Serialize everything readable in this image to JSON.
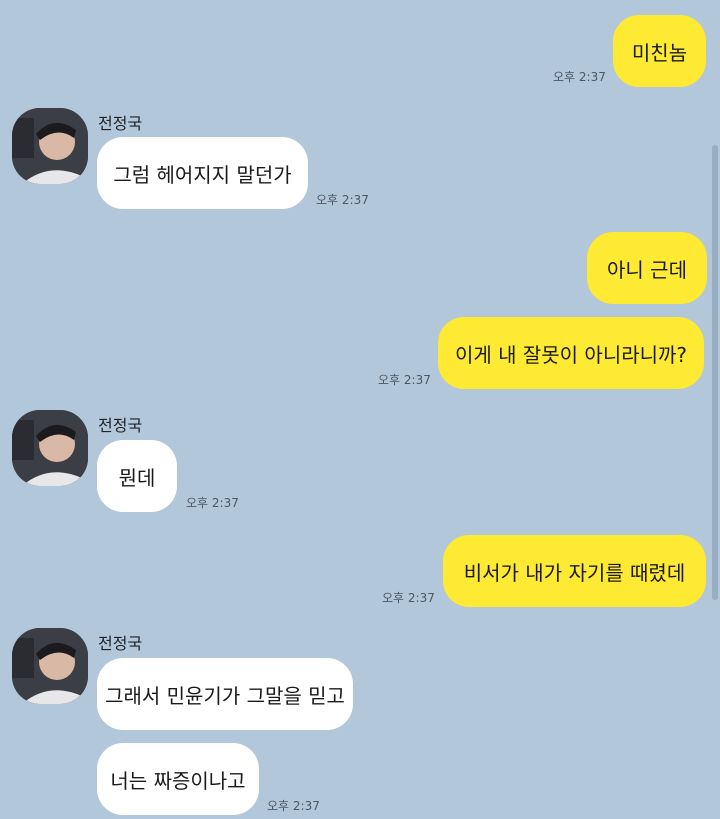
{
  "chat": {
    "sender_name": "전정국",
    "messages": [
      {
        "text": "미친놈",
        "time": "오후 2:37"
      },
      {
        "text": "그럼 헤어지지 말던가",
        "time": "오후 2:37"
      },
      {
        "text": "아니 근데"
      },
      {
        "text": "이게 내 잘못이 아니라니까?",
        "time": "오후 2:37"
      },
      {
        "text": "뭔데",
        "time": "오후 2:37"
      },
      {
        "text": "비서가 내가 자기를 때렸데",
        "time": "오후 2:37"
      },
      {
        "text": "그래서 민윤기가 그말을 믿고"
      },
      {
        "text": "너는 짜증이나고",
        "time": "오후 2:37"
      }
    ]
  },
  "colors": {
    "background": "#b2c7da",
    "my_bubble": "#fee933",
    "other_bubble": "#ffffff"
  },
  "icons": {
    "avatar": "profile-photo"
  }
}
